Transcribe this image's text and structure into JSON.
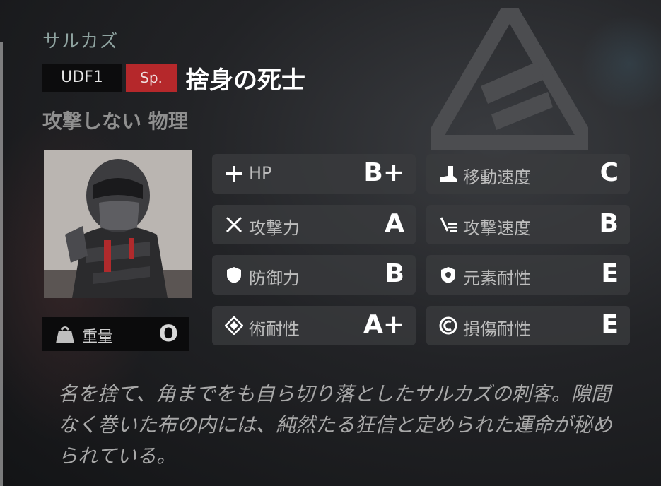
{
  "operator": {
    "faction": "サルカズ",
    "code": "UDF1",
    "class_badge": "Sp.",
    "name": "捨身の死士",
    "traits": "攻撃しない 物理"
  },
  "weight": {
    "label": "重量",
    "value": "O"
  },
  "stats_left": [
    {
      "icon": "plus-icon",
      "label": "HP",
      "grade": "B+"
    },
    {
      "icon": "crossed-swords-icon",
      "label": "攻撃力",
      "grade": "A"
    },
    {
      "icon": "shield-icon",
      "label": "防御力",
      "grade": "B"
    },
    {
      "icon": "diamond-icon",
      "label": "術耐性",
      "grade": "A+"
    }
  ],
  "stats_right": [
    {
      "icon": "boot-icon",
      "label": "移動速度",
      "grade": "C"
    },
    {
      "icon": "attack-speed-icon",
      "label": "攻撃速度",
      "grade": "B"
    },
    {
      "icon": "element-shield-icon",
      "label": "元素耐性",
      "grade": "E"
    },
    {
      "icon": "damage-ring-icon",
      "label": "損傷耐性",
      "grade": "E"
    }
  ],
  "description": "名を捨て、角までをも自ら切り落としたサルカズの刺客。隙間なく巻いた布の内には、純然たる狂信と定められた運命が秘められている。",
  "colors": {
    "badge_red": "#b5282b",
    "faction_teal": "#8fa3a0"
  }
}
